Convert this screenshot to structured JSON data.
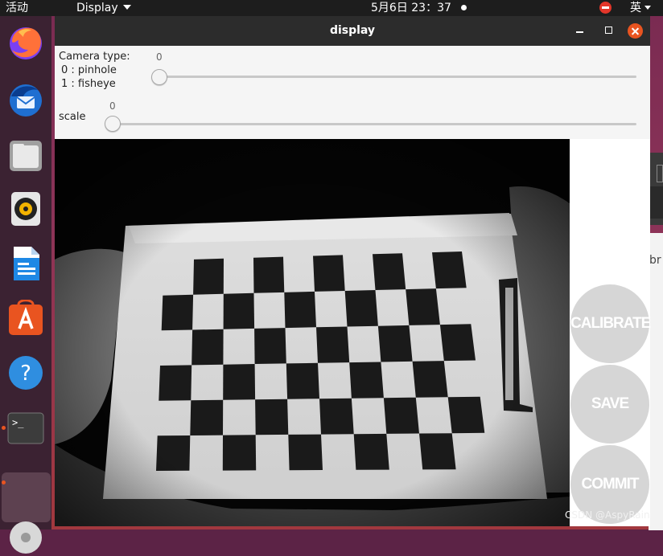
{
  "topbar": {
    "activities": "活动",
    "app_menu": "Display",
    "clock": "5月6日  23：37",
    "input_method": "英"
  },
  "dock": {
    "items": [
      "firefox-icon",
      "thunderbird-icon",
      "files-icon",
      "rhythmbox-icon",
      "libreoffice-writer-icon",
      "software-center-icon",
      "help-icon",
      "terminal-icon",
      "show-apps-icon"
    ]
  },
  "window": {
    "title": "display"
  },
  "controls": {
    "camera_type_label": "Camera type:",
    "camera_type_option_0": "0 : pinhole",
    "camera_type_option_1": "1 : fisheye",
    "camera_type_value": "0",
    "scale_label": "scale",
    "scale_value": "0"
  },
  "side_buttons": {
    "calibrate": "CALIBRATE",
    "save": "SAVE",
    "commit": "COMMIT"
  },
  "background_window": {
    "text": "br"
  },
  "watermark": "CSDN @AspyRain",
  "colors": {
    "accent": "#e95420",
    "titlebar": "#2c2c2c",
    "dock": "#3b2232",
    "button_bg": "#d6d6d6"
  }
}
